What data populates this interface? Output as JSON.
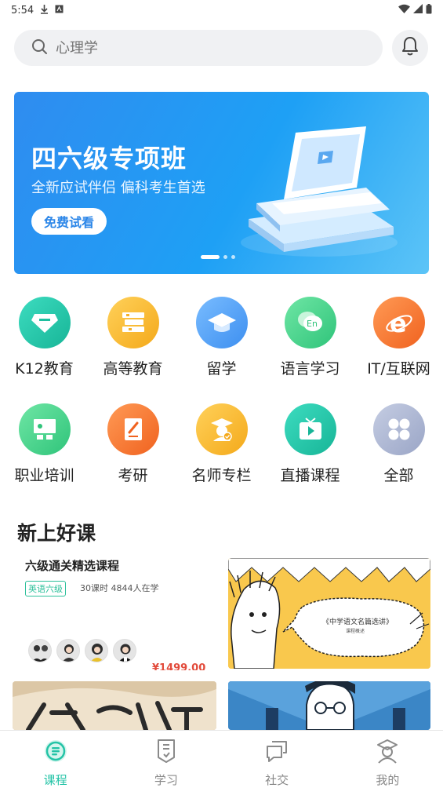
{
  "status": {
    "time": "5:54"
  },
  "search": {
    "placeholder": "心理学"
  },
  "banner": {
    "title": "四六级专项班",
    "subtitle": "全新应试伴侣 偏科考生首选",
    "button": "免费试看"
  },
  "categories": [
    {
      "label": "K12教育",
      "icon": "diamond-icon",
      "color": "#23c3a6"
    },
    {
      "label": "高等教育",
      "icon": "books-icon",
      "color": "#f7b52c"
    },
    {
      "label": "留学",
      "icon": "graduation-cap-icon",
      "color": "#4a9cf0"
    },
    {
      "label": "语言学习",
      "icon": "chat-en-icon",
      "color": "#3fcf85"
    },
    {
      "label": "IT/互联网",
      "icon": "browser-e-icon",
      "color": "#f5783a"
    },
    {
      "label": "职业培训",
      "icon": "classroom-icon",
      "color": "#3fcf85"
    },
    {
      "label": "考研",
      "icon": "notebook-pen-icon",
      "color": "#f5783a"
    },
    {
      "label": "名师专栏",
      "icon": "teacher-badge-icon",
      "color": "#f7b52c"
    },
    {
      "label": "直播课程",
      "icon": "tv-play-icon",
      "color": "#23c3a6"
    },
    {
      "label": "全部",
      "icon": "grid-all-icon",
      "color": "#a9b3cf"
    }
  ],
  "section": {
    "title": "新上好课"
  },
  "course": {
    "title": "六级通关精选课程",
    "tag": "英语六级",
    "meta": "30课时 4844人在学",
    "price": "¥1499.00"
  },
  "course_image": {
    "label": "《中学语文名篇选讲》",
    "sub": "课程概述"
  },
  "tabs": [
    {
      "label": "课程",
      "icon": "course-icon",
      "active": true
    },
    {
      "label": "学习",
      "icon": "study-icon",
      "active": false
    },
    {
      "label": "社交",
      "icon": "social-icon",
      "active": false
    },
    {
      "label": "我的",
      "icon": "profile-icon",
      "active": false
    }
  ],
  "colors": {
    "accent": "#23c3a6",
    "banner": "#2f8cf0",
    "price": "#e24b3b"
  }
}
